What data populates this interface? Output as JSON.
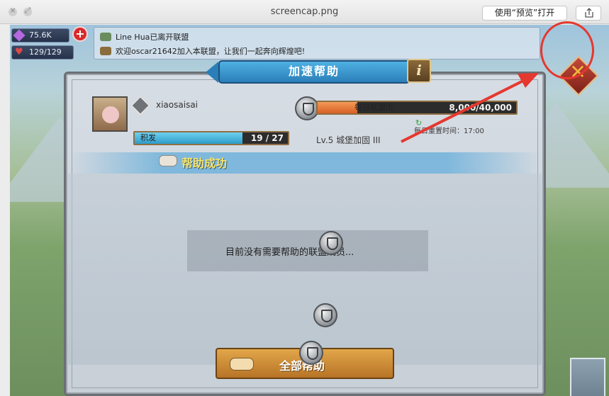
{
  "window": {
    "title": "screencap.png",
    "open_with_preview": "使用“预览”打开"
  },
  "resources": {
    "gems": "75.6K",
    "stamina": "129/129"
  },
  "chat": {
    "line1": "Line Hua已离开联盟",
    "line2": "欢迎oscar21642加入本联盟，让我们一起奔向辉煌吧!"
  },
  "dialog": {
    "title": "加速帮助",
    "info_label": "i",
    "player_name": "xiaosaisai",
    "daily_coins_label": "每日联盟币",
    "daily_coins_value": "8,000/40,000",
    "daily_coins_progress": 0.2,
    "activity_label": "积发",
    "activity_value": "19 / 27",
    "activity_progress": 0.7037,
    "level_text": "Lv.5 城堡加固 III",
    "refresh_text": "每日重置时间：17:00",
    "section_title": "帮助成功",
    "empty_message": "目前没有需要帮助的联盟成员...",
    "help_all_label": "全部帮助",
    "close_label": "✕"
  },
  "colors": {
    "annotation_red": "#e5382f",
    "title_blue": "#2a7fb8",
    "section_yellow": "#f4e36c"
  }
}
